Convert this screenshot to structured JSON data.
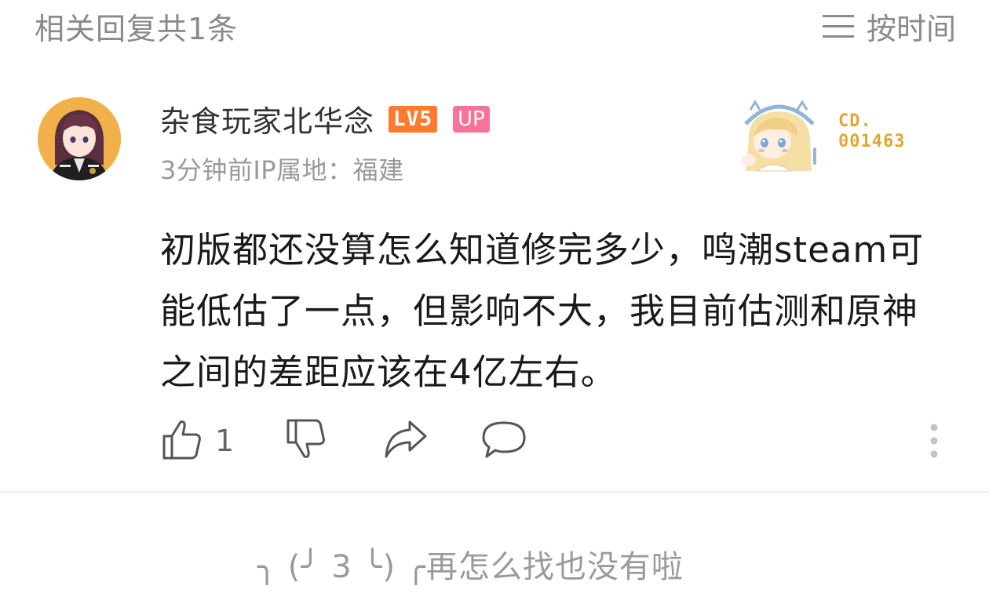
{
  "header": {
    "reply_count_label": "相关回复共1条",
    "sort_label": "按时间"
  },
  "comment": {
    "username": "杂食玩家北华念",
    "level_badge": "LV5",
    "up_badge": "UP",
    "meta": "3分钟前IP属地：福建",
    "decoration_code_line1": "CD.",
    "decoration_code_line2": "001463",
    "content": "初版都还没算怎么知道修完多少，鸣潮steam可能低估了一点，但影响不大，我目前估测和原神之间的差距应该在4亿左右。",
    "like_count": "1"
  },
  "footer": {
    "end_text": "╮ (╯ 3 ╰) ╭再怎么找也没有啦"
  },
  "colors": {
    "level_badge": "#ff7a2e",
    "up_badge": "#fb7299",
    "decoration_code": "#e2a634",
    "secondary_text": "#9a9a9a"
  },
  "icons": {
    "sort": "sort-lines-icon",
    "like": "thumbs-up-icon",
    "dislike": "thumbs-down-icon",
    "share": "share-arrow-icon",
    "reply": "comment-bubble-icon",
    "more": "more-vertical-icon"
  }
}
